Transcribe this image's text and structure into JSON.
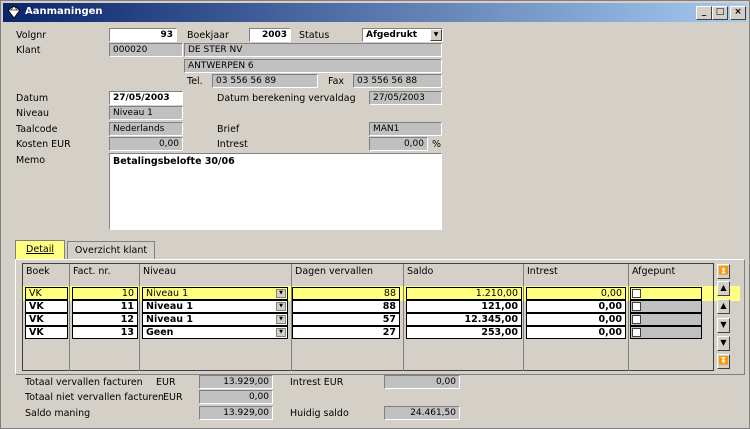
{
  "window": {
    "title": "Aanmaningen",
    "minimize": "_",
    "maximize": "□",
    "close": "×"
  },
  "header": {
    "volgnr_label": "Volgnr",
    "volgnr_value": "93",
    "boekjaar_label": "Boekjaar",
    "boekjaar_value": "2003",
    "status_label": "Status",
    "status_value": "Afgedrukt",
    "klant_label": "Klant",
    "klant_code": "000020",
    "klant_name": "DE STER NV",
    "klant_address": "ANTWERPEN 6",
    "tel_label": "Tel.",
    "tel_value": "03 556 56 89",
    "fax_label": "Fax",
    "fax_value": "03 556 56 88",
    "datum_label": "Datum",
    "datum_value": "27/05/2003",
    "verval_label": "Datum berekening vervaldag",
    "verval_value": "27/05/2003",
    "niveau_label": "Niveau",
    "niveau_value": "Niveau 1",
    "taalcode_label": "Taalcode",
    "taalcode_value": "Nederlands",
    "brief_label": "Brief",
    "brief_value": "MAN1",
    "kosten_label": "Kosten EUR",
    "kosten_value": "0,00",
    "intrest_label": "Intrest",
    "intrest_value": "0,00",
    "intrest_unit": "%",
    "memo_label": "Memo",
    "memo_value": "Betalingsbelofte 30/06"
  },
  "tabs": [
    {
      "label": "Detail"
    },
    {
      "label": "Overzicht klant"
    }
  ],
  "grid": {
    "columns": [
      "Boek",
      "Fact. nr.",
      "Niveau",
      "Dagen vervallen",
      "Saldo",
      "Intrest",
      "Afgepunt"
    ],
    "rows": [
      {
        "boek": "VK",
        "factnr": "10",
        "niveau": "Niveau 1",
        "dagen": "88",
        "saldo": "1.210,00",
        "intrest": "0,00"
      },
      {
        "boek": "VK",
        "factnr": "11",
        "niveau": "Niveau 1",
        "dagen": "88",
        "saldo": "121,00",
        "intrest": "0,00"
      },
      {
        "boek": "VK",
        "factnr": "12",
        "niveau": "Niveau 1",
        "dagen": "57",
        "saldo": "12.345,00",
        "intrest": "0,00"
      },
      {
        "boek": "VK",
        "factnr": "13",
        "niveau": "Geen",
        "dagen": "27",
        "saldo": "253,00",
        "intrest": "0,00"
      }
    ]
  },
  "totals": {
    "vervallen_label": "Totaal vervallen facturen",
    "vervallen_unit": "EUR",
    "vervallen_value": "13.929,00",
    "niet_vervallen_label": "Totaal niet vervallen facturen",
    "niet_vervallen_unit": "EUR",
    "niet_vervallen_value": "0,00",
    "saldo_label": "Saldo maning",
    "saldo_value": "13.929,00",
    "intrest_label": "Intrest EUR",
    "intrest_value": "0,00",
    "huidig_label": "Huidig saldo",
    "huidig_value": "24.461,50"
  }
}
